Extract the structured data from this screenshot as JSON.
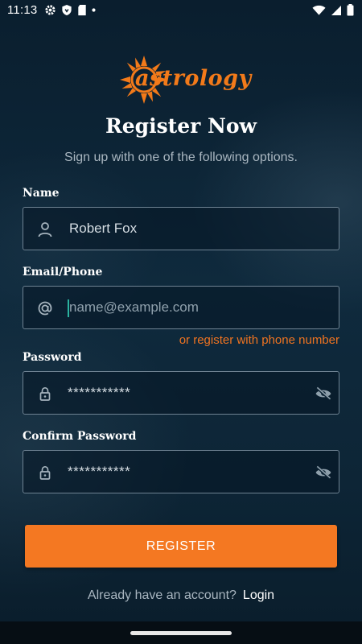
{
  "status_bar": {
    "time": "11:13",
    "left_icons": [
      "gear-icon",
      "shield-icon",
      "sd-card-icon",
      "dot-icon"
    ],
    "right_icons": [
      "wifi-icon",
      "signal-icon",
      "battery-icon"
    ]
  },
  "logo": {
    "text": "astrology",
    "icon": "sun-icon"
  },
  "header": {
    "title": "Register Now",
    "subtitle": "Sign up with one of the following options."
  },
  "form": {
    "name": {
      "label": "Name",
      "value": "Robert Fox",
      "icon": "person-icon"
    },
    "email": {
      "label": "Email/Phone",
      "placeholder": "name@example.com",
      "value": "",
      "icon": "at-icon"
    },
    "alt_link": "or register with phone number",
    "password": {
      "label": "Password",
      "value": "***********",
      "icon": "lock-icon",
      "toggle_icon": "eye-off-icon"
    },
    "confirm_password": {
      "label": "Confirm Password",
      "value": "***********",
      "icon": "lock-icon",
      "toggle_icon": "eye-off-icon"
    }
  },
  "actions": {
    "register_label": "REGISTER"
  },
  "footer": {
    "prompt": "Already have an account?",
    "login_label": "Login"
  },
  "colors": {
    "accent": "#f47822",
    "background": "#0f2a3d",
    "field_border": "#6e8292"
  }
}
